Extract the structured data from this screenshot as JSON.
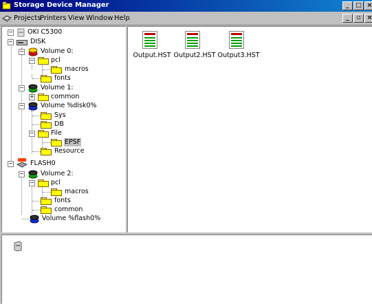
{
  "window": {
    "title": "Storage Device Manager",
    "controls": [
      "_",
      "□",
      "×"
    ],
    "doc_controls": [
      "_",
      "▫",
      "×"
    ]
  },
  "menu": {
    "items": [
      "Projects",
      "Printers",
      "View",
      "Window",
      "Help"
    ]
  },
  "tree": {
    "device": "OKI C5300",
    "disk": "DISK",
    "vol0": "Volume 0:",
    "pcl": "pcl",
    "macros": "macros",
    "fonts": "fonts",
    "vol1": "Volume 1:",
    "common": "common",
    "vol_disk": "Volume %disk0%",
    "sys": "Sys",
    "db": "DB",
    "file": "File",
    "epsf": "EPSF",
    "resource": "Resource",
    "flash": "FLASH0",
    "vol2": "Volume 2:",
    "pcl2": "pcl",
    "macros2": "macros",
    "fonts2": "fonts",
    "common2": "common",
    "vol_flash": "Volume %flash0%"
  },
  "files": [
    "Output.HST",
    "Output2.HST",
    "Output3.HST"
  ],
  "colors": {
    "title_bar": "#000080",
    "folder": "#ffff00",
    "disk_red": "#d01010",
    "disk_green": "#10a010",
    "disk_blue": "#1030d0"
  }
}
